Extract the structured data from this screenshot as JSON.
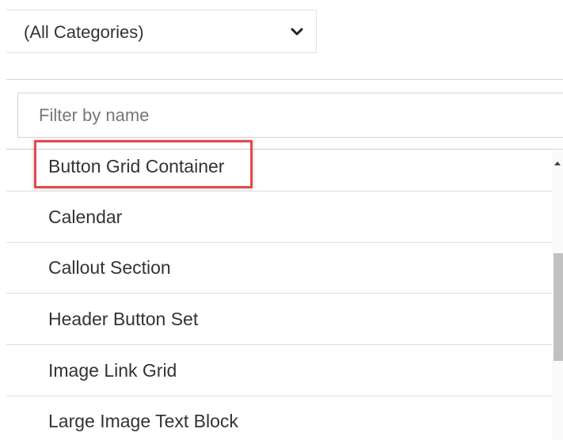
{
  "category_select": {
    "value": "(All Categories)",
    "icon": "chevron-down-icon"
  },
  "filter": {
    "placeholder": "Filter by name",
    "value": ""
  },
  "components": [
    {
      "label": "Button Grid Container",
      "highlighted": true
    },
    {
      "label": "Calendar"
    },
    {
      "label": "Callout Section"
    },
    {
      "label": "Header Button Set"
    },
    {
      "label": "Image Link Grid"
    },
    {
      "label": "Large Image Text Block"
    }
  ],
  "colors": {
    "highlight_border": "#e5484d",
    "text": "#333333",
    "scroll_thumb": "#c1c1c1"
  }
}
